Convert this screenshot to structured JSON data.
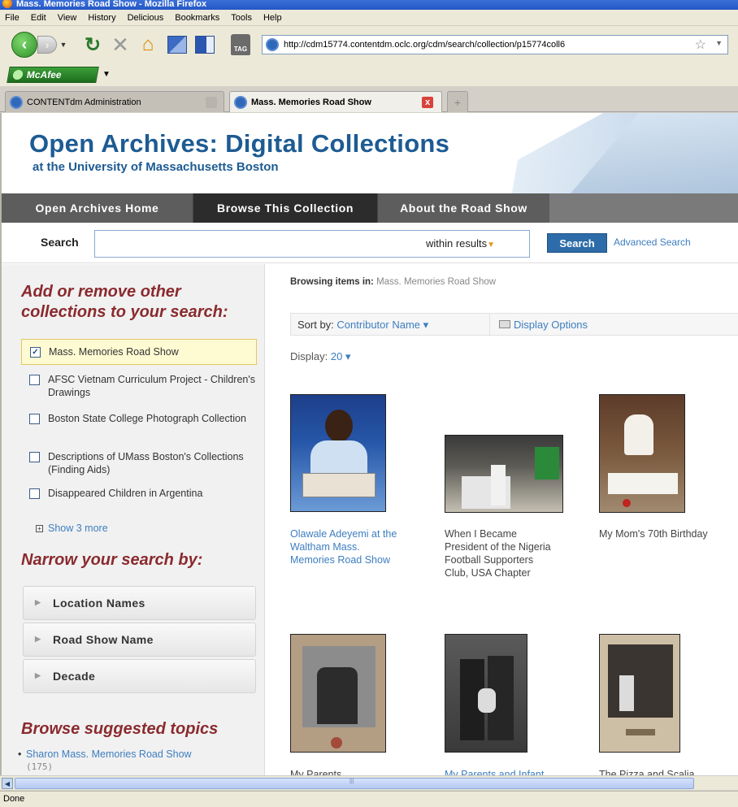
{
  "window": {
    "title": "Mass. Memories Road Show - Mozilla Firefox"
  },
  "menu": [
    "File",
    "Edit",
    "View",
    "History",
    "Delicious",
    "Bookmarks",
    "Tools",
    "Help"
  ],
  "toolbar": {
    "url": "http://cdm15774.contentdm.oclc.org/cdm/search/collection/p15774coll6",
    "tag_label": "TAG",
    "mcafee_label": "McAfee"
  },
  "tabs": [
    {
      "label": "CONTENTdm Administration"
    },
    {
      "label": "Mass. Memories Road Show",
      "close": "x"
    }
  ],
  "newtab_label": "+",
  "banner": {
    "title": "Open Archives: Digital Collections",
    "subtitle": "at the University of Massachusetts Boston"
  },
  "sitenav": [
    "Open Archives Home",
    "Browse This Collection",
    "About the Road Show"
  ],
  "search": {
    "label": "Search",
    "within": "within results",
    "button": "Search",
    "advanced": "Advanced Search"
  },
  "sidebar": {
    "add_heading": "Add or remove other collections to your search:",
    "collections": [
      {
        "label": "Mass. Memories Road Show",
        "checked": true
      },
      {
        "label": "AFSC Vietnam Curriculum Project - Children's Drawings",
        "checked": false
      },
      {
        "label": "Boston State College Photograph Collection",
        "checked": false
      },
      {
        "label": "Descriptions of UMass Boston's Collections (Finding Aids)",
        "checked": false
      },
      {
        "label": "Disappeared Children in Argentina",
        "checked": false
      }
    ],
    "show_more": "Show 3 more",
    "narrow_heading": "Narrow your search by:",
    "facets": [
      "Location Names",
      "Road Show Name",
      "Decade"
    ],
    "suggest_heading": "Browse suggested topics",
    "suggest_item": "Sharon Mass. Memories Road Show",
    "suggest_count": "(175)"
  },
  "main": {
    "breadcrumb_label": "Browsing items in:",
    "breadcrumb_value": "Mass. Memories Road Show",
    "sort_label": "Sort by:",
    "sort_value": "Contributor Name",
    "display_options": "Display Options",
    "display_label": "Display:",
    "display_value": "20",
    "items": [
      {
        "caption": "Olawale Adeyemi at the Waltham Mass. Memories Road Show",
        "link": true
      },
      {
        "caption": "When I Became President of the Nigeria Football Supporters Club, USA Chapter",
        "link": false
      },
      {
        "caption": "My Mom's 70th Birthday",
        "link": false
      },
      {
        "caption": "My Parents",
        "link": false
      },
      {
        "caption": "My Parents and Infant",
        "link": true
      },
      {
        "caption": "The Pizza and Scalia",
        "link": false
      }
    ]
  },
  "status": "Done"
}
